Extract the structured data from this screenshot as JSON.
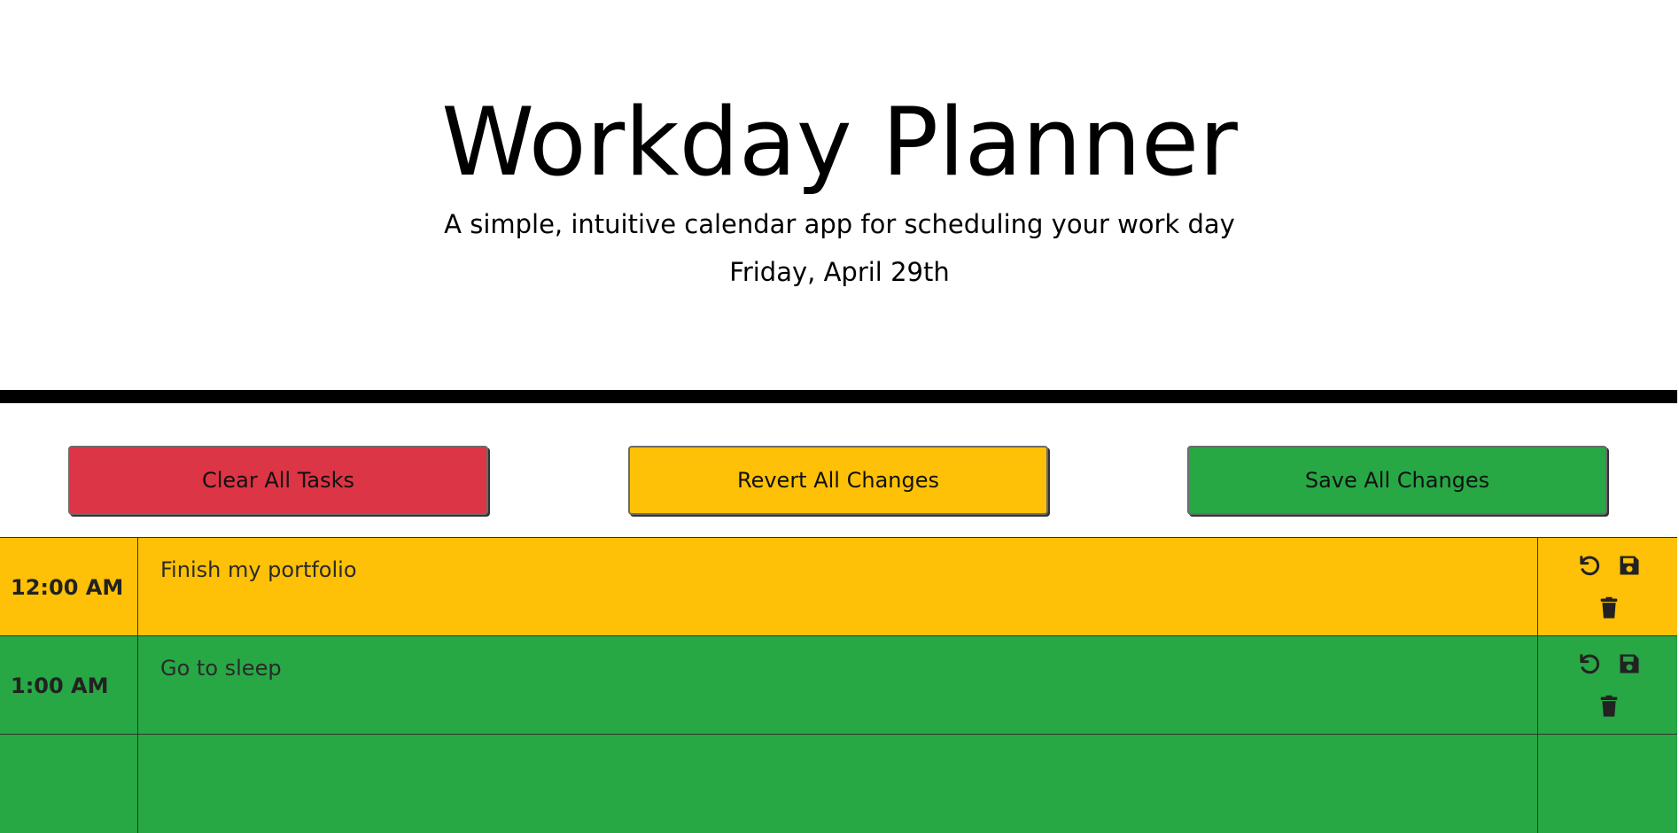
{
  "header": {
    "title": "Workday Planner",
    "subtitle": "A simple, intuitive calendar app for scheduling your work day",
    "date": "Friday, April 29th"
  },
  "toolbar": {
    "clear_label": "Clear All Tasks",
    "revert_label": "Revert All Changes",
    "save_label": "Save All Changes"
  },
  "colors": {
    "clear": "#dc3545",
    "revert": "#ffc107",
    "save": "#28a745",
    "present": "#ffc107",
    "future": "#28a745"
  },
  "rows": [
    {
      "hour": "12:00 AM",
      "task": "Finish my portfolio",
      "state": "present"
    },
    {
      "hour": "1:00 AM",
      "task": "Go to sleep",
      "state": "future"
    },
    {
      "hour": "",
      "task": "",
      "state": "future"
    }
  ],
  "row_icons": [
    "undo-icon",
    "save-icon",
    "trash-icon"
  ]
}
